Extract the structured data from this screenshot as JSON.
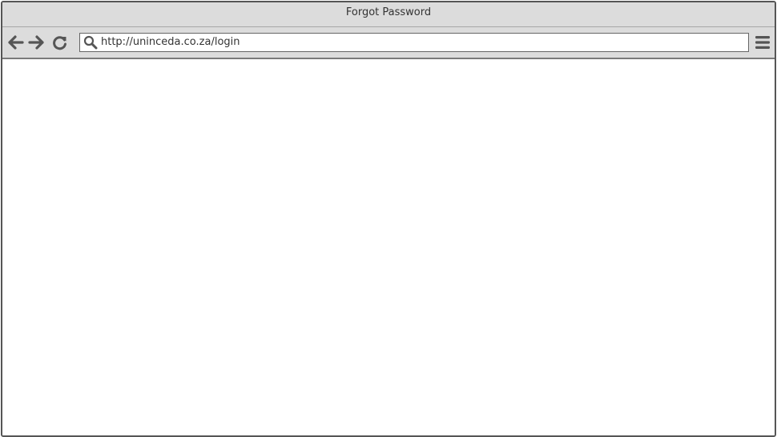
{
  "window": {
    "title": "Forgot Password"
  },
  "toolbar": {
    "url": "http://uninceda.co.za/login",
    "icons": [
      "back-arrow-icon",
      "forward-arrow-icon",
      "reload-icon",
      "search-icon",
      "menu-icon"
    ]
  },
  "colors": {
    "chrome": "#dcdcdc",
    "border": "#555555",
    "icon": "#555555",
    "text": "#333333"
  }
}
